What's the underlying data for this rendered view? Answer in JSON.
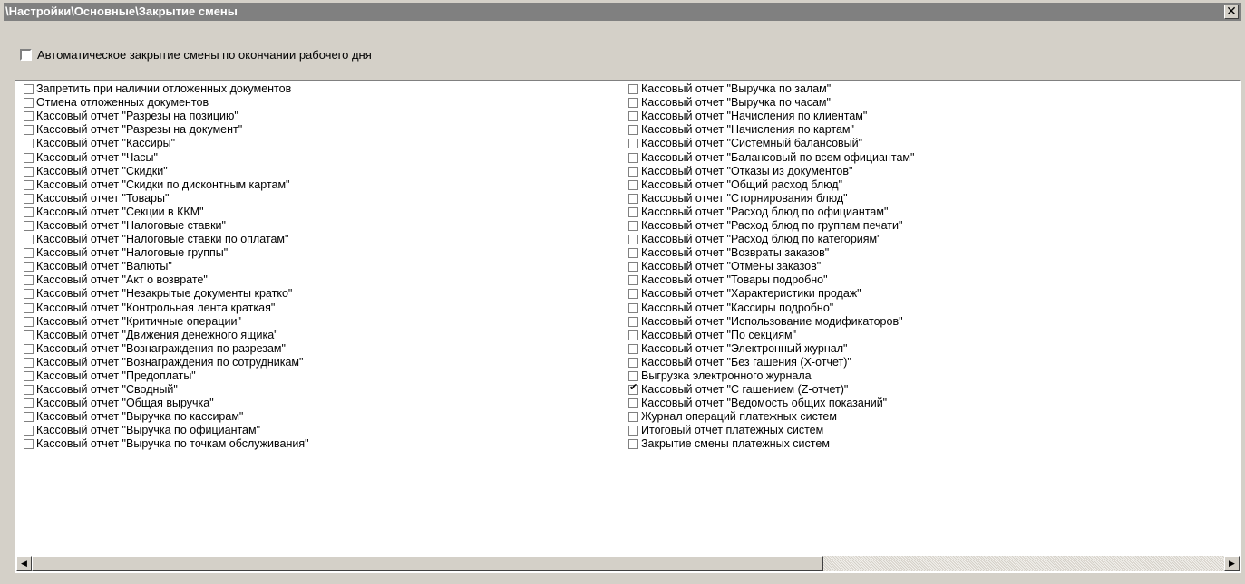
{
  "window": {
    "title": "\\Настройки\\Основные\\Закрытие смены",
    "close_glyph": "✕"
  },
  "auto_close": {
    "label": "Автоматическое закрытие смены по окончании рабочего дня",
    "checked": false
  },
  "left_items": [
    {
      "label": "Запретить при наличии отложенных документов",
      "checked": false
    },
    {
      "label": "Отмена отложенных документов",
      "checked": false
    },
    {
      "label": "Кассовый отчет \"Разрезы на позицию\"",
      "checked": false
    },
    {
      "label": "Кассовый отчет \"Разрезы на документ\"",
      "checked": false
    },
    {
      "label": "Кассовый отчет \"Кассиры\"",
      "checked": false
    },
    {
      "label": "Кассовый отчет \"Часы\"",
      "checked": false
    },
    {
      "label": "Кассовый отчет \"Скидки\"",
      "checked": false
    },
    {
      "label": "Кассовый отчет \"Скидки по дисконтным картам\"",
      "checked": false
    },
    {
      "label": "Кассовый отчет \"Товары\"",
      "checked": false
    },
    {
      "label": "Кассовый отчет \"Секции в ККМ\"",
      "checked": false
    },
    {
      "label": "Кассовый отчет \"Налоговые ставки\"",
      "checked": false
    },
    {
      "label": "Кассовый отчет \"Налоговые ставки по оплатам\"",
      "checked": false
    },
    {
      "label": "Кассовый отчет \"Налоговые группы\"",
      "checked": false
    },
    {
      "label": "Кассовый отчет \"Валюты\"",
      "checked": false
    },
    {
      "label": "Кассовый отчет \"Акт о возврате\"",
      "checked": false
    },
    {
      "label": "Кассовый отчет \"Незакрытые документы кратко\"",
      "checked": false
    },
    {
      "label": "Кассовый отчет \"Контрольная лента краткая\"",
      "checked": false
    },
    {
      "label": "Кассовый отчет \"Критичные операции\"",
      "checked": false
    },
    {
      "label": "Кассовый отчет \"Движения денежного ящика\"",
      "checked": false
    },
    {
      "label": "Кассовый отчет \"Вознаграждения по разрезам\"",
      "checked": false
    },
    {
      "label": "Кассовый отчет \"Вознаграждения по сотрудникам\"",
      "checked": false
    },
    {
      "label": "Кассовый отчет \"Предоплаты\"",
      "checked": false
    },
    {
      "label": "Кассовый отчет \"Сводный\"",
      "checked": false
    },
    {
      "label": "Кассовый отчет \"Общая выручка\"",
      "checked": false
    },
    {
      "label": "Кассовый отчет \"Выручка по кассирам\"",
      "checked": false
    },
    {
      "label": "Кассовый отчет \"Выручка по официантам\"",
      "checked": false
    },
    {
      "label": "Кассовый отчет \"Выручка по точкам обслуживания\"",
      "checked": false
    }
  ],
  "right_items": [
    {
      "label": "Кассовый отчет \"Выручка по залам\"",
      "checked": false
    },
    {
      "label": "Кассовый отчет \"Выручка по часам\"",
      "checked": false
    },
    {
      "label": "Кассовый отчет \"Начисления по клиентам\"",
      "checked": false
    },
    {
      "label": "Кассовый отчет \"Начисления по картам\"",
      "checked": false
    },
    {
      "label": "Кассовый отчет \"Системный балансовый\"",
      "checked": false
    },
    {
      "label": "Кассовый отчет \"Балансовый по всем официантам\"",
      "checked": false
    },
    {
      "label": "Кассовый отчет \"Отказы из документов\"",
      "checked": false
    },
    {
      "label": "Кассовый отчет \"Общий расход блюд\"",
      "checked": false
    },
    {
      "label": "Кассовый отчет \"Сторнирования блюд\"",
      "checked": false
    },
    {
      "label": "Кассовый отчет \"Расход блюд по официантам\"",
      "checked": false
    },
    {
      "label": "Кассовый отчет \"Расход блюд по группам печати\"",
      "checked": false
    },
    {
      "label": "Кассовый отчет \"Расход блюд по категориям\"",
      "checked": false
    },
    {
      "label": "Кассовый отчет \"Возвраты заказов\"",
      "checked": false
    },
    {
      "label": "Кассовый отчет \"Отмены заказов\"",
      "checked": false
    },
    {
      "label": "Кассовый отчет \"Товары подробно\"",
      "checked": false
    },
    {
      "label": "Кассовый отчет \"Характеристики продаж\"",
      "checked": false
    },
    {
      "label": "Кассовый отчет \"Кассиры подробно\"",
      "checked": false
    },
    {
      "label": "Кассовый отчет \"Использование модификаторов\"",
      "checked": false
    },
    {
      "label": "Кассовый отчет \"По секциям\"",
      "checked": false
    },
    {
      "label": "Кассовый отчет \"Электронный журнал\"",
      "checked": false
    },
    {
      "label": "Кассовый отчет \"Без гашения (X-отчет)\"",
      "checked": false
    },
    {
      "label": "Выгрузка электронного журнала",
      "checked": false
    },
    {
      "label": "Кассовый отчет \"С гашением (Z-отчет)\"",
      "checked": true
    },
    {
      "label": "Кассовый отчет \"Ведомость общих показаний\"",
      "checked": false
    },
    {
      "label": "Журнал операций платежных систем",
      "checked": false
    },
    {
      "label": "Итоговый отчет платежных систем",
      "checked": false
    },
    {
      "label": "Закрытие смены платежных систем",
      "checked": false
    }
  ],
  "scrollbar": {
    "left_glyph": "◀",
    "right_glyph": "▶",
    "position": 0
  }
}
